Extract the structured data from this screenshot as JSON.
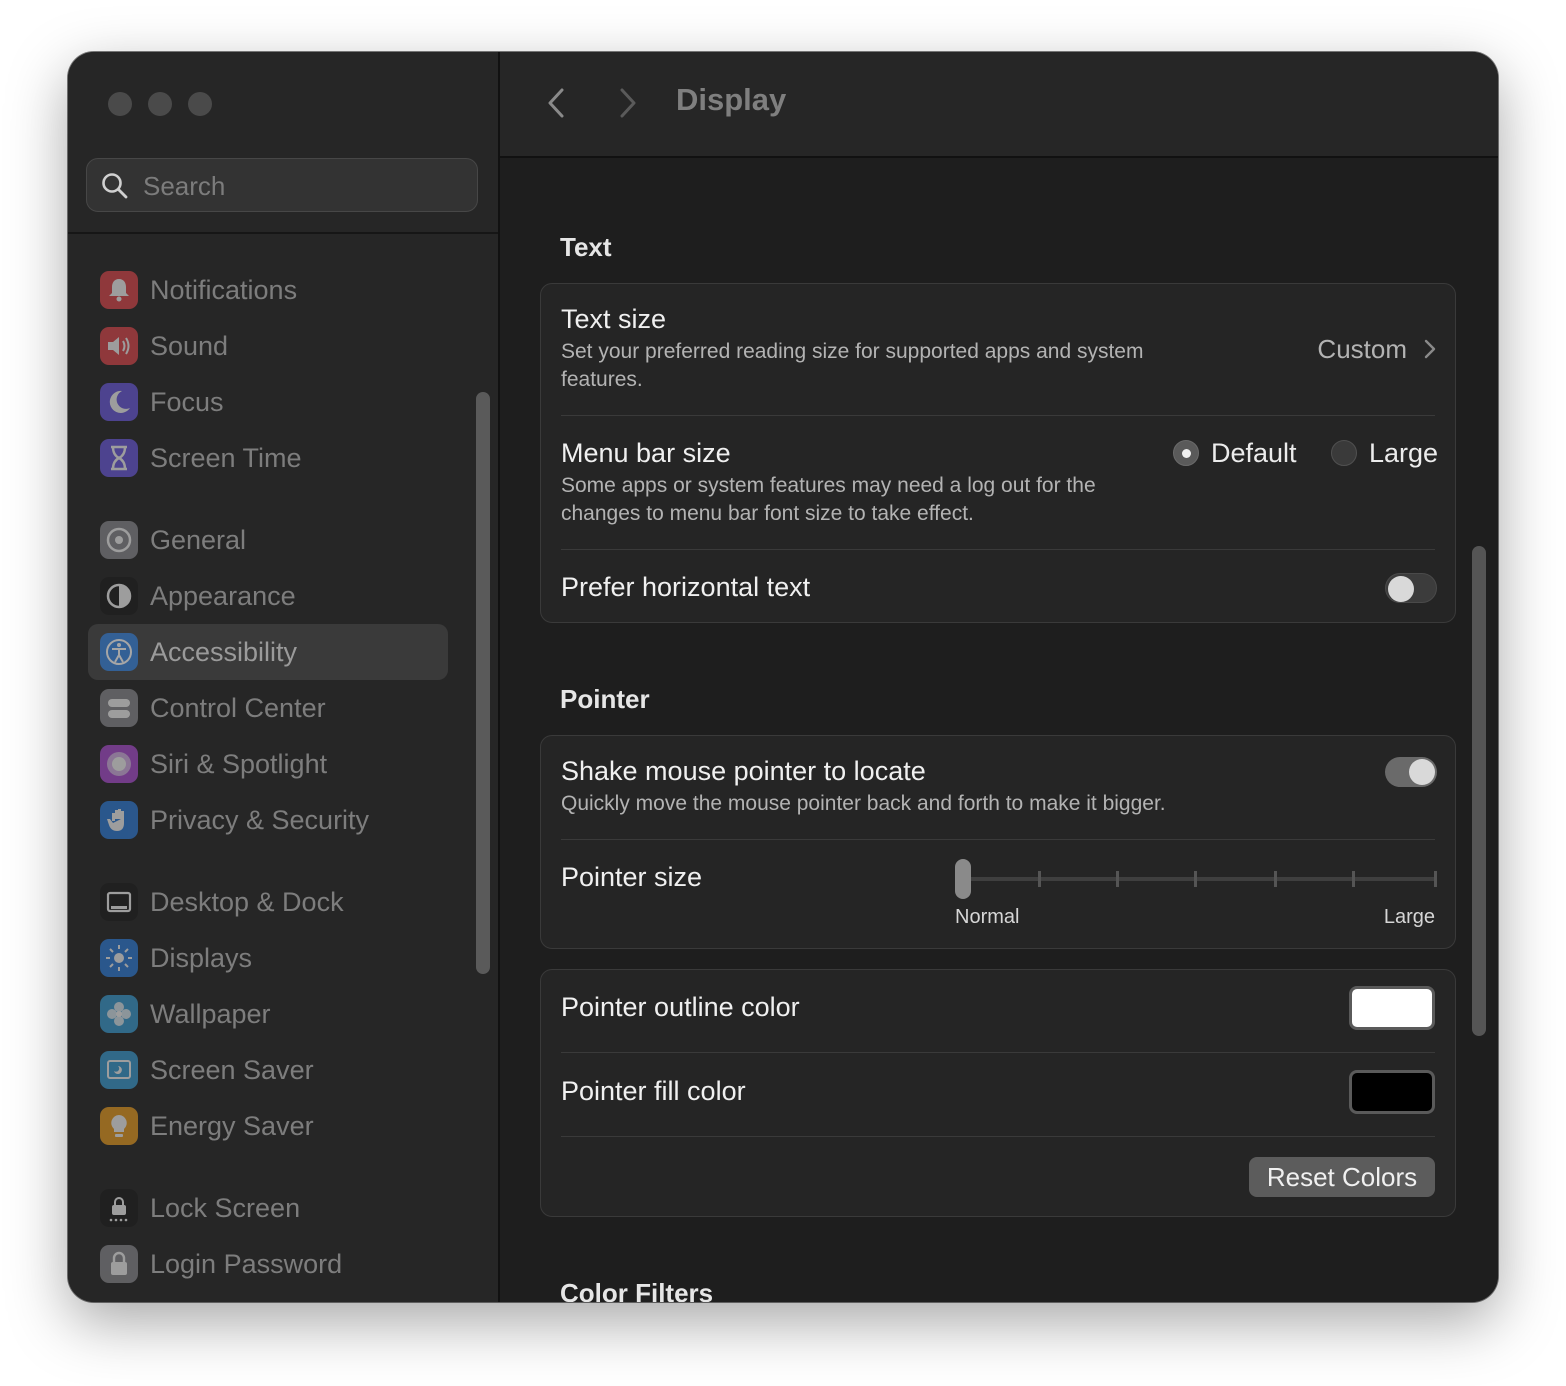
{
  "window": {
    "title": "Display"
  },
  "search": {
    "placeholder": "Search"
  },
  "sidebar": {
    "groups": [
      [
        {
          "label": "Notifications",
          "icon": "bell-icon",
          "color": "#e5484d"
        },
        {
          "label": "Sound",
          "icon": "speaker-icon",
          "color": "#e5484d"
        },
        {
          "label": "Focus",
          "icon": "moon-icon",
          "color": "#6e5ce6"
        },
        {
          "label": "Screen Time",
          "icon": "hourglass-icon",
          "color": "#6e5ce6"
        }
      ],
      [
        {
          "label": "General",
          "icon": "gear-icon",
          "color": "#8e8e93"
        },
        {
          "label": "Appearance",
          "icon": "appearance-icon",
          "color": "#1c1c1c"
        },
        {
          "label": "Accessibility",
          "icon": "accessibility-icon",
          "color": "#2f7fe0",
          "selected": true
        },
        {
          "label": "Control Center",
          "icon": "control-center-icon",
          "color": "#8e8e93"
        },
        {
          "label": "Siri & Spotlight",
          "icon": "siri-icon",
          "color": "#b04fd9"
        },
        {
          "label": "Privacy & Security",
          "icon": "hand-icon",
          "color": "#2f7fe0"
        }
      ],
      [
        {
          "label": "Desktop & Dock",
          "icon": "dock-icon",
          "color": "#1c1c1c"
        },
        {
          "label": "Displays",
          "icon": "sun-icon",
          "color": "#2f7fe0"
        },
        {
          "label": "Wallpaper",
          "icon": "flower-icon",
          "color": "#3aa0d8"
        },
        {
          "label": "Screen Saver",
          "icon": "screen-saver-icon",
          "color": "#3aa0d8"
        },
        {
          "label": "Energy Saver",
          "icon": "bulb-icon",
          "color": "#f0a020"
        }
      ],
      [
        {
          "label": "Lock Screen",
          "icon": "lock-screen-icon",
          "color": "#1c1c1c"
        },
        {
          "label": "Login Password",
          "icon": "padlock-icon",
          "color": "#8e8e93"
        }
      ]
    ]
  },
  "sections": {
    "text": {
      "title": "Text",
      "text_size": {
        "title": "Text size",
        "description": "Set your preferred reading size for supported apps and system features.",
        "value": "Custom"
      },
      "menu_bar_size": {
        "title": "Menu bar size",
        "description": "Some apps or system features may need a log out for the changes to menu bar font size to take effect.",
        "options": [
          "Default",
          "Large"
        ],
        "selected": "Default"
      },
      "prefer_horizontal_text": {
        "title": "Prefer horizontal text",
        "enabled": false
      }
    },
    "pointer": {
      "title": "Pointer",
      "shake_to_locate": {
        "title": "Shake mouse pointer to locate",
        "description": "Quickly move the mouse pointer back and forth to make it bigger.",
        "enabled": true
      },
      "pointer_size": {
        "title": "Pointer size",
        "min_label": "Normal",
        "max_label": "Large",
        "value_fraction": 0.0
      },
      "outline_color": {
        "title": "Pointer outline color",
        "color": "#ffffff"
      },
      "fill_color": {
        "title": "Pointer fill color",
        "color": "#000000"
      },
      "reset_label": "Reset Colors"
    },
    "color_filters": {
      "title": "Color Filters"
    }
  }
}
